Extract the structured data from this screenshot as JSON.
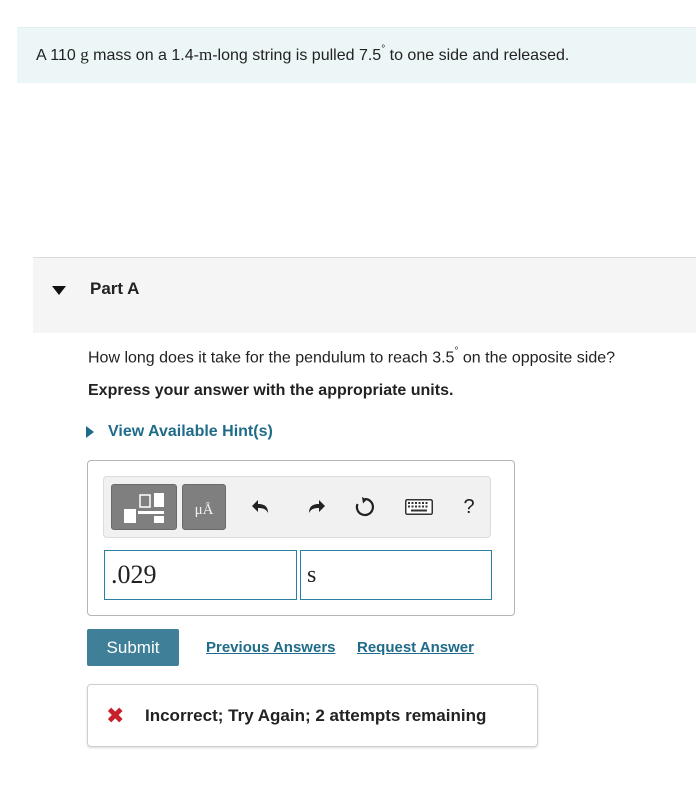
{
  "problem": {
    "part1": "A 110 ",
    "unit_g": "g",
    "part2": " mass on a 1.4-",
    "unit_m": "m",
    "part3": "-long string is pulled 7.5",
    "degree": "°",
    "part4": "  to one side and released."
  },
  "part_a": {
    "title": "Part A",
    "question_main": "How long does it take for the pendulum to reach 3.5",
    "question_degree": "°",
    "question_end": "  on the opposite side?",
    "instruction": "Express your answer with the appropriate units.",
    "hint_label": "View Available Hint(s)"
  },
  "toolbar": {
    "templates_icon": "templates-icon",
    "units_label": "μÅ",
    "undo_icon": "undo-icon",
    "redo_icon": "redo-icon",
    "reset_icon": "reset-icon",
    "keyboard_icon": "keyboard-icon",
    "help_label": "?"
  },
  "answer": {
    "value": ".029",
    "unit": "s"
  },
  "actions": {
    "submit_label": "Submit",
    "previous_answers_label": "Previous Answers",
    "request_answer_label": "Request Answer"
  },
  "feedback": {
    "icon": "x-icon",
    "message": "Incorrect; Try Again; 2 attempts remaining"
  },
  "colors": {
    "accent": "#1f6b8a",
    "submit_bg": "#3f7f98",
    "error": "#c8202a",
    "problem_bg": "#ecf6f7"
  }
}
